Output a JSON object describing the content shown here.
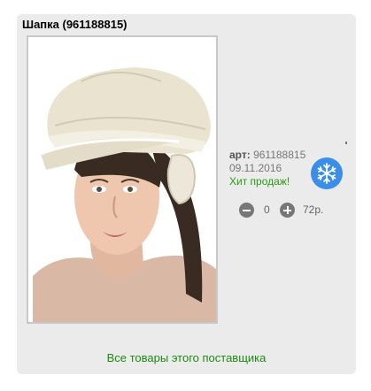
{
  "product": {
    "title": "Шапка (961188815)",
    "image_alt": "Шапка",
    "art_label": "арт:",
    "art_value": "961188815",
    "date": "09.11.2016",
    "badge": "Хит продаж!",
    "season_icon": "snowflake-icon"
  },
  "cart": {
    "quantity": "0",
    "price": "72р.",
    "minus_icon": "minus-circle-icon",
    "plus_icon": "plus-circle-icon"
  },
  "supplier_link": "Все товары этого поставщика",
  "colors": {
    "card_bg": "#ebebeb",
    "link_green": "#1d8a12",
    "badge_green": "#2a9a16",
    "snow_blue": "#3b8ee8"
  }
}
